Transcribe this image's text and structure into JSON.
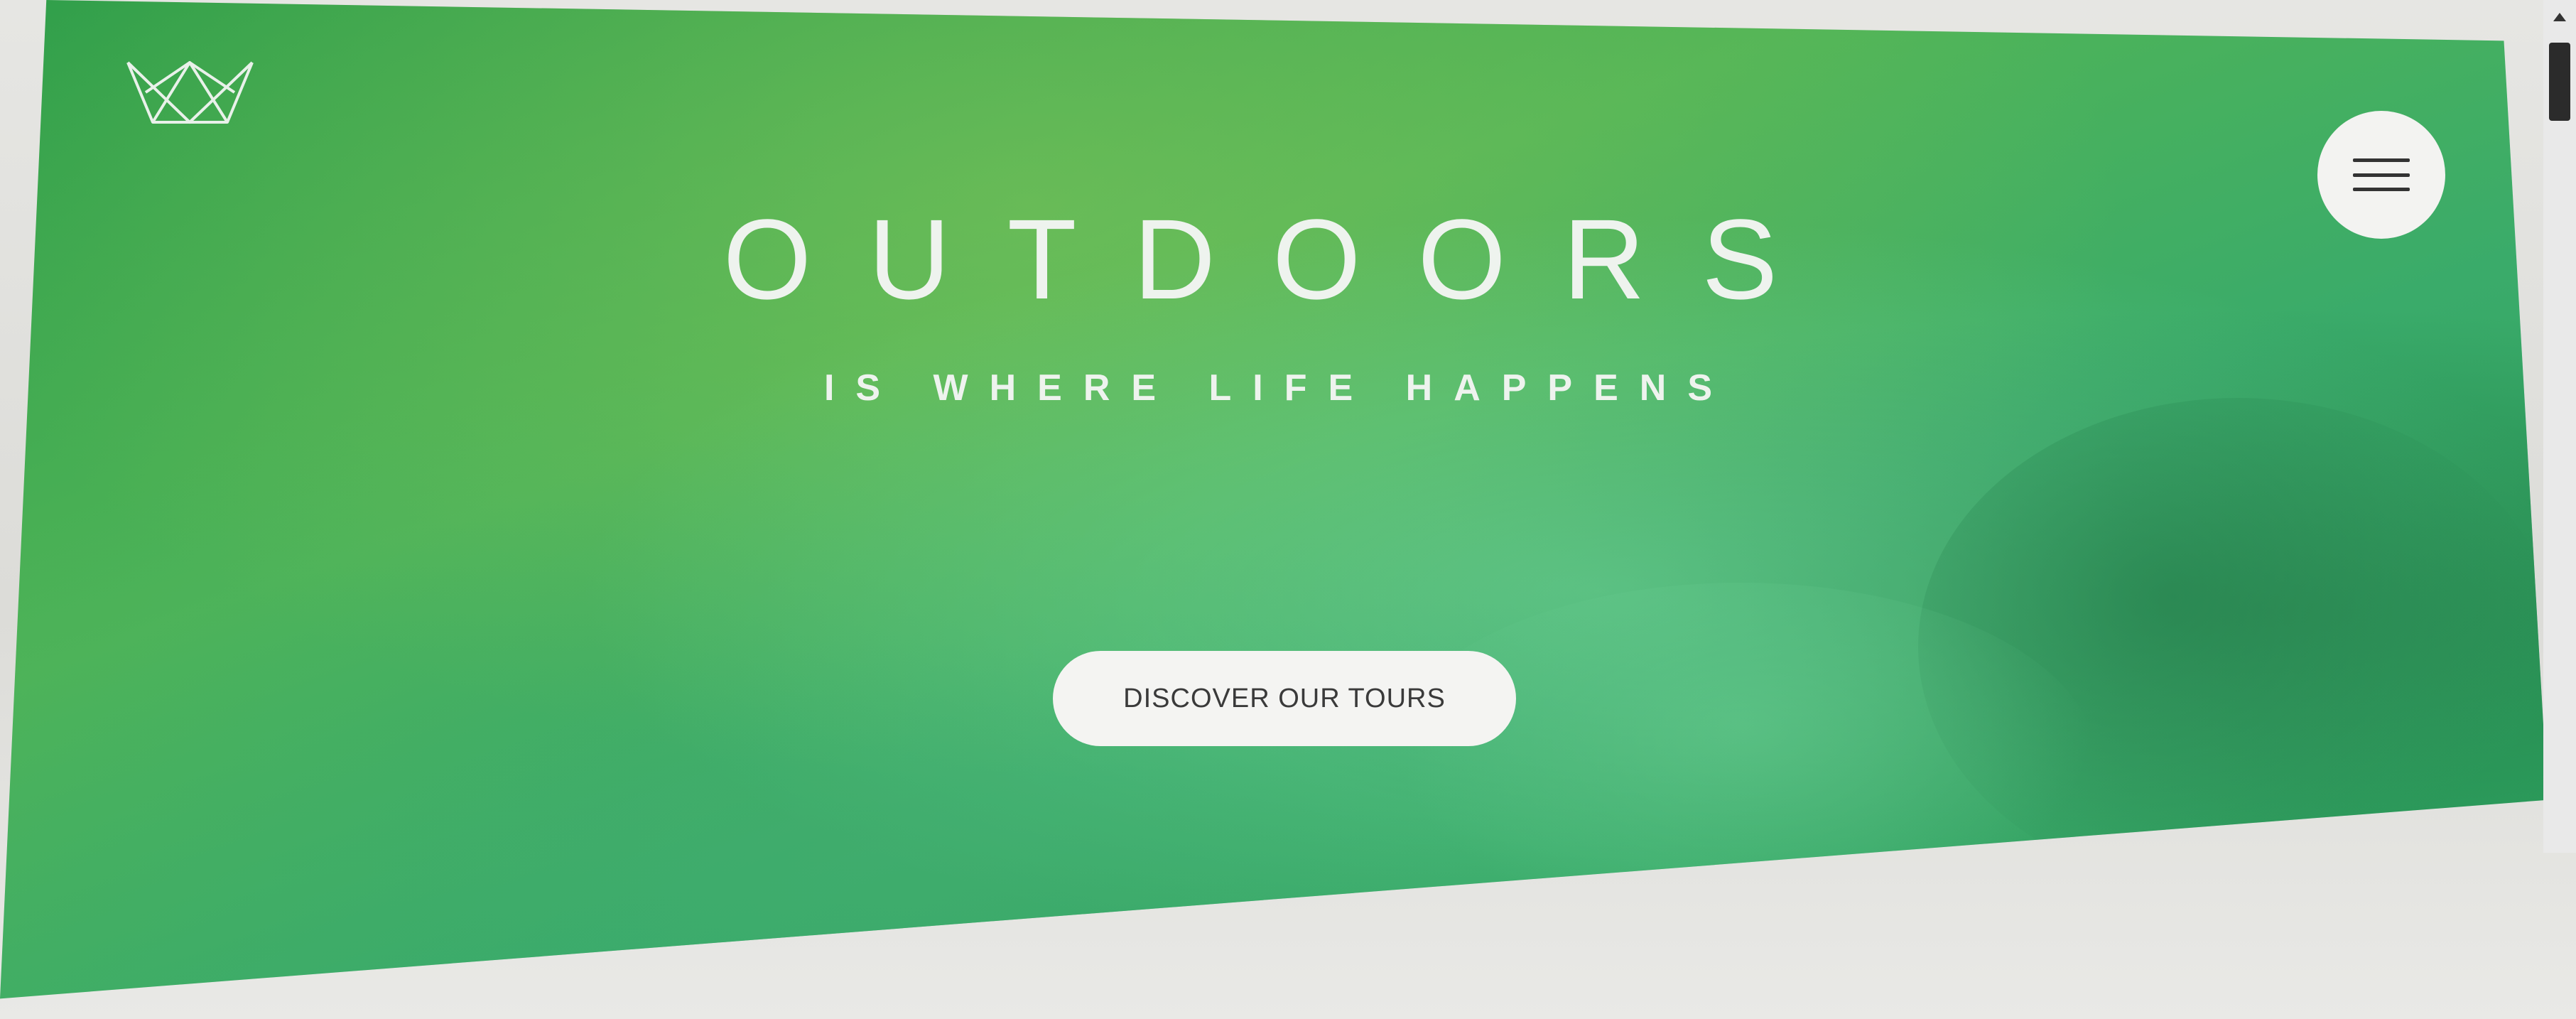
{
  "hero": {
    "title": "OUTDOORS",
    "subtitle": "IS WHERE LIFE HAPPENS",
    "cta_label": "DISCOVER OUR TOURS"
  },
  "header": {
    "logo_icon": "crown-icon",
    "menu_icon": "hamburger-menu-icon"
  },
  "colors": {
    "hero_green": "#3aab6a",
    "text_light": "#eef3ee",
    "button_bg": "#f4f4f2",
    "button_text": "#3a3a3a"
  }
}
